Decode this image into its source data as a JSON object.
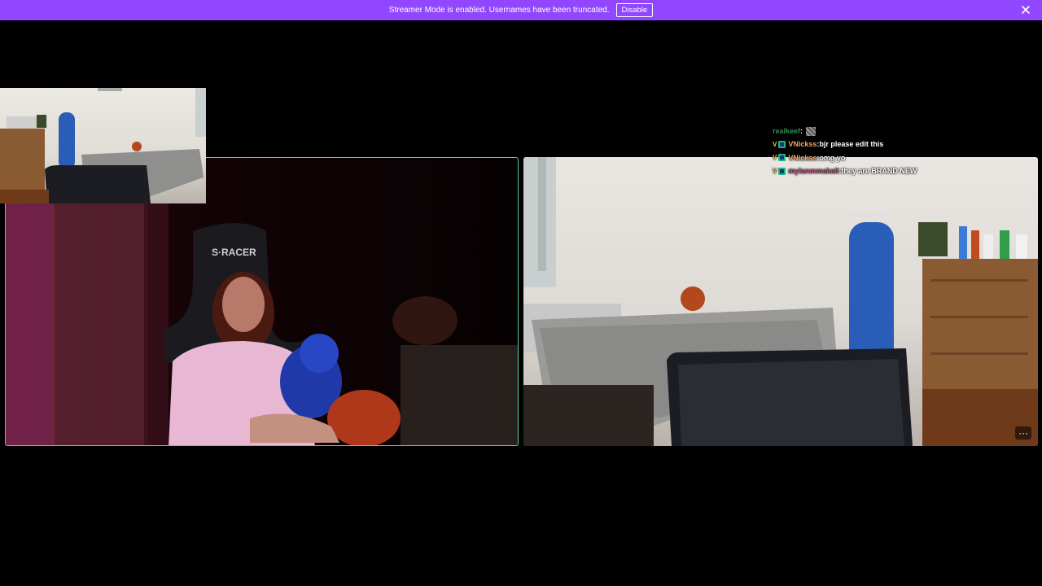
{
  "banner": {
    "message": "Streamer Mode is enabled. Usernames have been truncated.",
    "disable_label": "Disable",
    "bg_color": "#9147ff",
    "close_icon": "close-icon"
  },
  "chat": {
    "messages": [
      {
        "user": "realkeef",
        "user_color": "#2e8b57",
        "separator": " :",
        "text": "",
        "has_emote": true,
        "badges": []
      },
      {
        "user": "VNickss",
        "user_color": "#f4a460",
        "separator": " : ",
        "text": "bjr please edit this",
        "has_emote": false,
        "badges": [
          "v",
          "sq"
        ]
      },
      {
        "user": "VNickss",
        "user_color": "#f4a460",
        "separator": " : ",
        "text": "omg yo",
        "has_emote": false,
        "badges": [
          "v",
          "sq"
        ]
      },
      {
        "user": "mylanmmakali",
        "user_color": "#c0507a",
        "separator": " : ",
        "text": "they are BRAND NEW",
        "has_emote": false,
        "badges": [
          "v",
          "sq"
        ]
      }
    ]
  },
  "videos": {
    "left_stream": "streamer-webcam",
    "right_stream": "bedroom-camera",
    "pip_stream": "bedroom-camera-preview",
    "more_label": "···",
    "active_border_color": "#5fcf9a"
  }
}
